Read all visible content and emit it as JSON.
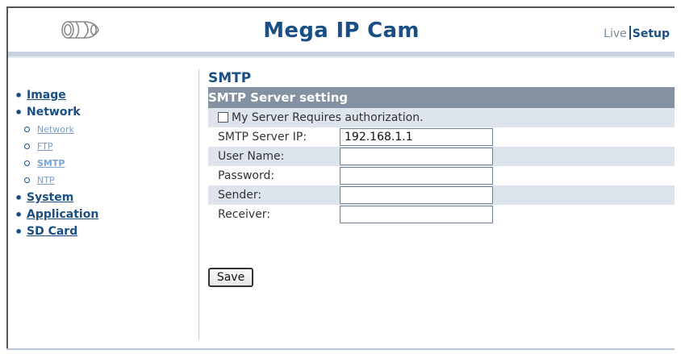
{
  "header": {
    "title": "Mega IP Cam",
    "nav_live": "Live",
    "nav_setup": "Setup",
    "logo_icon": "camera-lens-icon"
  },
  "sidebar": {
    "items": [
      {
        "label": "Image"
      },
      {
        "label": "Network",
        "children": [
          {
            "label": "Network"
          },
          {
            "label": "FTP"
          },
          {
            "label": "SMTP",
            "active": true
          },
          {
            "label": "NTP"
          }
        ]
      },
      {
        "label": "System"
      },
      {
        "label": "Application"
      },
      {
        "label": "SD Card"
      }
    ]
  },
  "main": {
    "page_title": "SMTP",
    "section_title": "SMTP Server setting",
    "auth_label": "My Server Requires authorization.",
    "auth_checked": false,
    "fields": [
      {
        "label": "SMTP Server IP:",
        "value": "192.168.1.1"
      },
      {
        "label": "User Name:",
        "value": ""
      },
      {
        "label": "Password:",
        "value": ""
      },
      {
        "label": "Sender:",
        "value": ""
      },
      {
        "label": "Receiver:",
        "value": ""
      }
    ],
    "save_label": "Save"
  },
  "colors": {
    "brand": "#1a4f86",
    "section_bar": "#8391a1",
    "row_shade": "#dde4ec",
    "sub_link": "#7a9dc4"
  }
}
